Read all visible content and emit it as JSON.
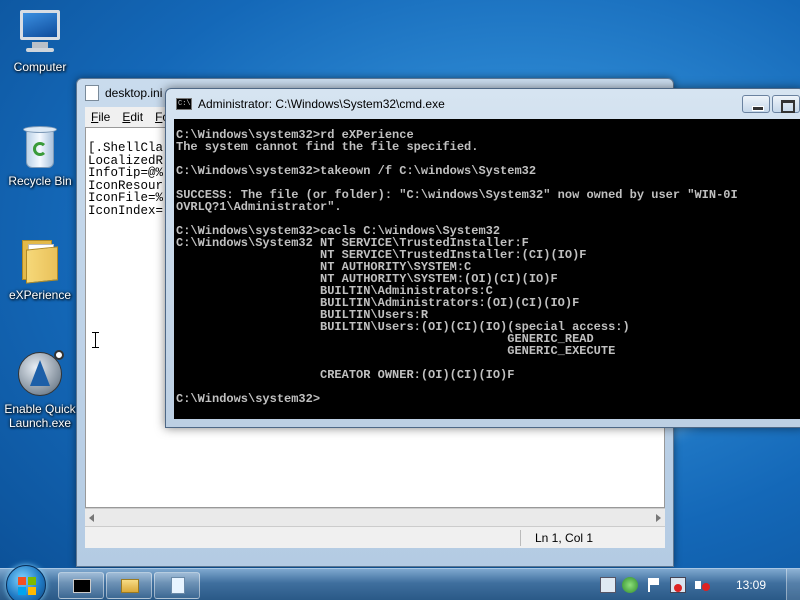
{
  "desktop": {
    "icons": [
      {
        "label": "Computer",
        "icon": "computer-icon"
      },
      {
        "label": "Recycle Bin",
        "icon": "recycle-bin-icon"
      },
      {
        "label": "eXPerience",
        "icon": "folder-icon"
      },
      {
        "label": "Enable Quick Launch.exe",
        "icon": "quick-launch-icon"
      }
    ]
  },
  "notepad": {
    "title": "desktop.ini",
    "menu": [
      "File",
      "Edit",
      "Fo"
    ],
    "text": "[.ShellCla\nLocalizedR\nInfoTip=@%\nIconResour\nIconFile=%\nIconIndex=",
    "status_position": "Ln 1, Col 1"
  },
  "cmd": {
    "title": "Administrator: C:\\Windows\\System32\\cmd.exe",
    "icon_text": "C:\\",
    "output": "C:\\Windows\\system32>rd eXPerience\nThe system cannot find the file specified.\n\nC:\\Windows\\system32>takeown /f C:\\windows\\System32\n\nSUCCESS: The file (or folder): \"C:\\windows\\System32\" now owned by user \"WIN-0I\nOVRLQ?1\\Administrator\".\n\nC:\\Windows\\system32>cacls C:\\windows\\System32\nC:\\Windows\\System32 NT SERVICE\\TrustedInstaller:F\n                    NT SERVICE\\TrustedInstaller:(CI)(IO)F\n                    NT AUTHORITY\\SYSTEM:C\n                    NT AUTHORITY\\SYSTEM:(OI)(CI)(IO)F\n                    BUILTIN\\Administrators:C\n                    BUILTIN\\Administrators:(OI)(CI)(IO)F\n                    BUILTIN\\Users:R\n                    BUILTIN\\Users:(OI)(CI)(IO)(special access:)\n                                              GENERIC_READ\n                                              GENERIC_EXECUTE\n\n                    CREATOR OWNER:(OI)(CI)(IO)F\n\nC:\\Windows\\system32>"
  },
  "taskbar": {
    "clock": "13:09",
    "buttons": [
      "cmd-icon",
      "explorer-icon",
      "notepad-icon"
    ],
    "tray": [
      "action-center-icon",
      "network-icon",
      "flag-icon",
      "display-icon",
      "volume-muted-icon"
    ]
  }
}
